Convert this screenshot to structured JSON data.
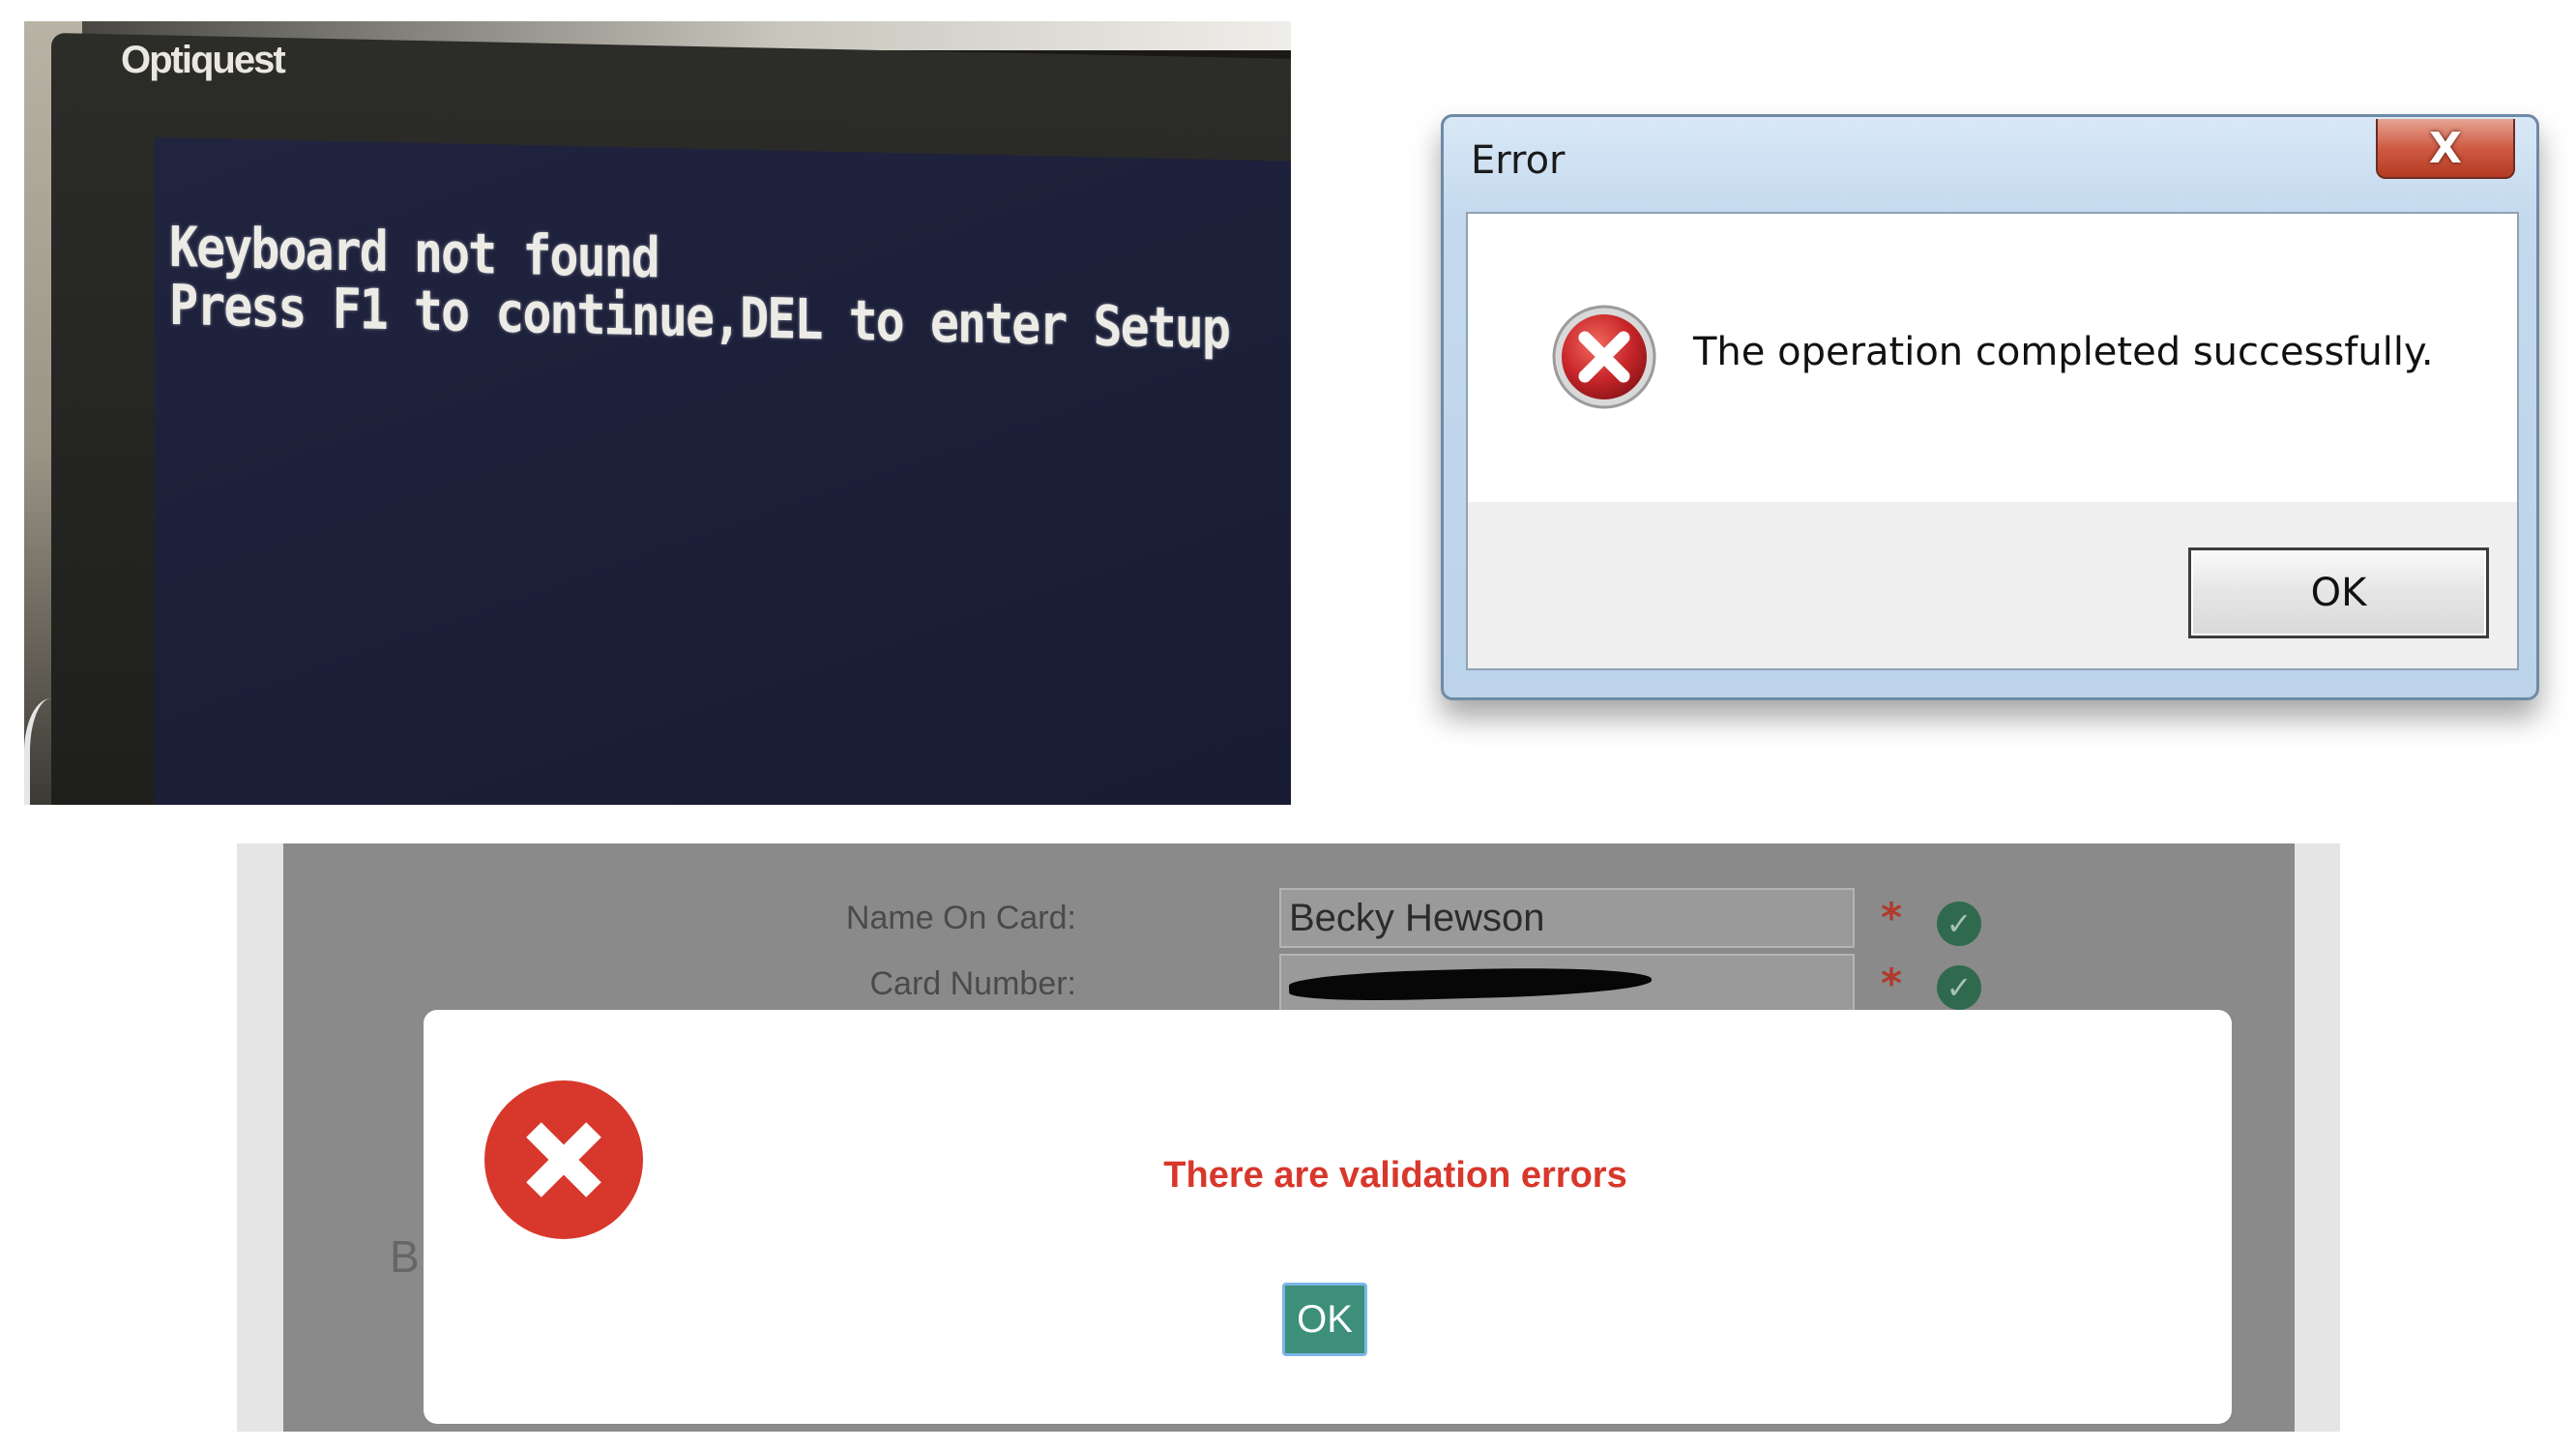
{
  "bios_photo": {
    "brand": "Optiquest",
    "line1": "Keyboard not found",
    "line2": "Press F1 to continue,DEL to enter Setup"
  },
  "windows_dialog": {
    "title": "Error",
    "close_glyph": "X",
    "message": "The operation completed successfully.",
    "ok_label": "OK",
    "icon": "error-x-icon",
    "accent": "#c8262a"
  },
  "web_form": {
    "name_label": "Name On Card:",
    "name_value": "Becky Hewson",
    "card_label": "Card Number:",
    "required_marker": "*",
    "valid_icon": "check-circle-icon",
    "partial_text": "B",
    "modal": {
      "message": "There are validation errors",
      "ok_label": "OK",
      "icon": "error-x-icon",
      "message_color": "#d8372b",
      "button_color": "#3d8f7a"
    }
  }
}
